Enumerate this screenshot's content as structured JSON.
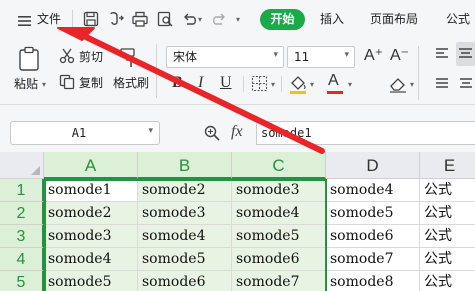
{
  "menubar": {
    "file_label": "文件",
    "tabs": [
      {
        "id": "start",
        "label": "开始"
      },
      {
        "id": "insert",
        "label": "插入"
      },
      {
        "id": "page_layout",
        "label": "页面布局"
      },
      {
        "id": "formula",
        "label": "公式"
      }
    ]
  },
  "ribbon": {
    "paste_label": "粘贴",
    "cut_label": "剪切",
    "copy_label": "复制",
    "format_painter_label": "格式刷",
    "font_name": "宋体",
    "font_size": "11",
    "bold": "B",
    "italic": "I",
    "underline": "U",
    "font_color_glyph": "A",
    "grow_font": "A⁺",
    "shrink_font": "A⁻",
    "accent_color": "#1ba94c"
  },
  "formula_bar": {
    "name_box": "A1",
    "fx_label": "fx",
    "formula_value": "somode1"
  },
  "grid": {
    "columns": [
      "A",
      "B",
      "C",
      "D",
      "E"
    ],
    "rows": [
      {
        "n": "1",
        "cells": [
          "somode1",
          "somode2",
          "somode3",
          "somode4",
          "公式"
        ]
      },
      {
        "n": "2",
        "cells": [
          "somode2",
          "somode3",
          "somode4",
          "somode5",
          "公式"
        ]
      },
      {
        "n": "3",
        "cells": [
          "somode3",
          "somode4",
          "somode5",
          "somode6",
          "公式"
        ]
      },
      {
        "n": "4",
        "cells": [
          "somode4",
          "somode5",
          "somode6",
          "somode7",
          "公式"
        ]
      },
      {
        "n": "5",
        "cells": [
          "somode5",
          "somode6",
          "somode7",
          "somode8",
          "公式"
        ]
      }
    ],
    "selection_color": "#26913f",
    "arrow_color": "#e8262a"
  }
}
